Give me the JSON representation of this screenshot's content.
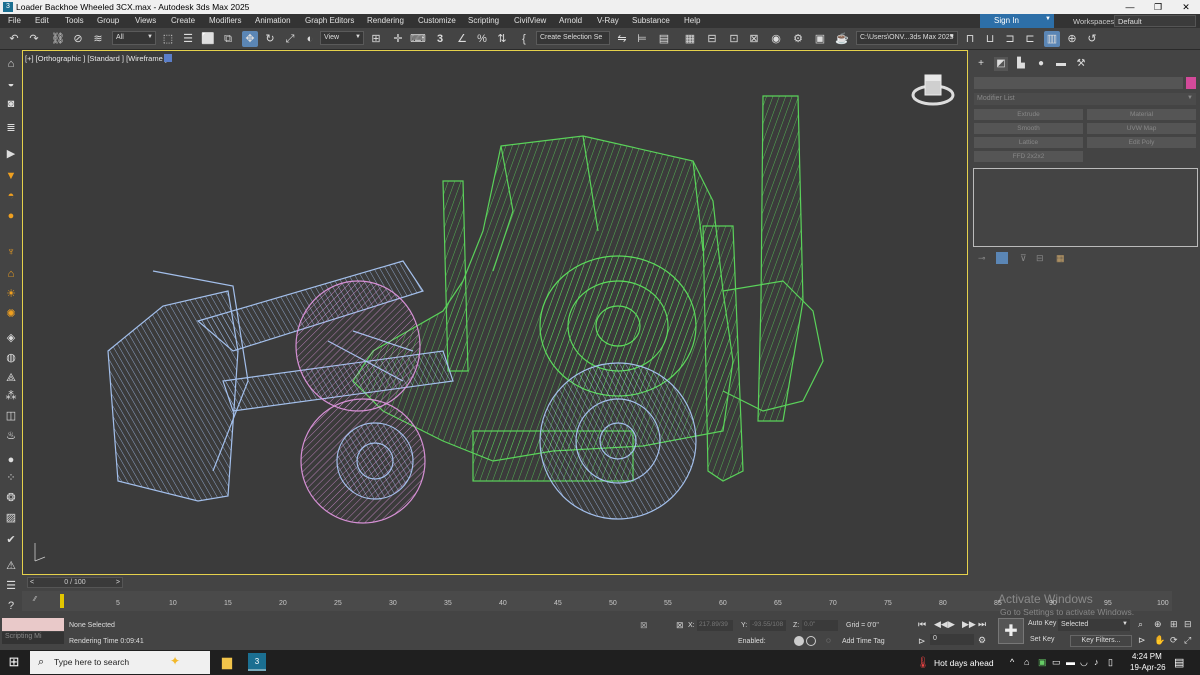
{
  "window": {
    "title": "Loader Backhoe Wheeled 3CX.max - Autodesk 3ds Max 2025",
    "controls": [
      "—",
      "❐",
      "✕"
    ]
  },
  "menu": [
    "File",
    "Edit",
    "Tools",
    "Group",
    "Views",
    "Create",
    "Modifiers",
    "Animation",
    "Graph Editors",
    "Rendering",
    "Customize",
    "Scripting",
    "CivilView",
    "Arnold",
    "V-Ray",
    "Substance",
    "Help"
  ],
  "account": {
    "sign_in": "Sign In",
    "workspaces_label": "Workspaces:",
    "workspace": "Default"
  },
  "toolbar": {
    "filter": "All",
    "ref_coord": "View",
    "snap_3": "3",
    "selection_set": "Create Selection Se",
    "project_path": "C:\\Users\\ONV...3ds Max 2025"
  },
  "viewport": {
    "label": "[+] [Orthographic ] [Standard ] [Wireframe ]",
    "colors": {
      "green": "#5ee35e",
      "blue": "#a9c7f5",
      "pink": "#e79ae6",
      "border": "#e5d14c"
    }
  },
  "command_panel": {
    "modifier_list": "Modifier List",
    "buttons": [
      "Extrude",
      "Material",
      "Smooth",
      "UVW Map",
      "Lattice",
      "Edit Poly",
      "FFD 2x2x2"
    ]
  },
  "timeline": {
    "frame": "0 / 100",
    "ticks": [
      "5",
      "10",
      "15",
      "20",
      "25",
      "30",
      "35",
      "40",
      "45",
      "50",
      "55",
      "60",
      "65",
      "70",
      "75",
      "80",
      "85",
      "90",
      "95",
      "100"
    ]
  },
  "status": {
    "script": "Scripting Mi",
    "selection": "None Selected",
    "render_time": "Rendering Time 0:09:41",
    "x_label": "X:",
    "x_val": "217.89/39",
    "y_label": "Y:",
    "y_val": "-93.55/108",
    "z_label": "Z:",
    "z_val": "0.0\"",
    "grid": "Grid = 0'0\"",
    "enabled": "Enabled:",
    "add_time_tag": "Add Time Tag",
    "auto_key": "Auto Key",
    "set_key": "Set Key",
    "selected": "Selected",
    "key_filters": "Key Filters...",
    "frame_field": "0"
  },
  "watermark": {
    "line1": "Activate Windows",
    "line2": "Go to Settings to activate Windows."
  },
  "taskbar": {
    "search_placeholder": "Type here to search",
    "weather": "Hot days ahead",
    "time": "4:24 PM",
    "date": "19-Apr-26"
  }
}
